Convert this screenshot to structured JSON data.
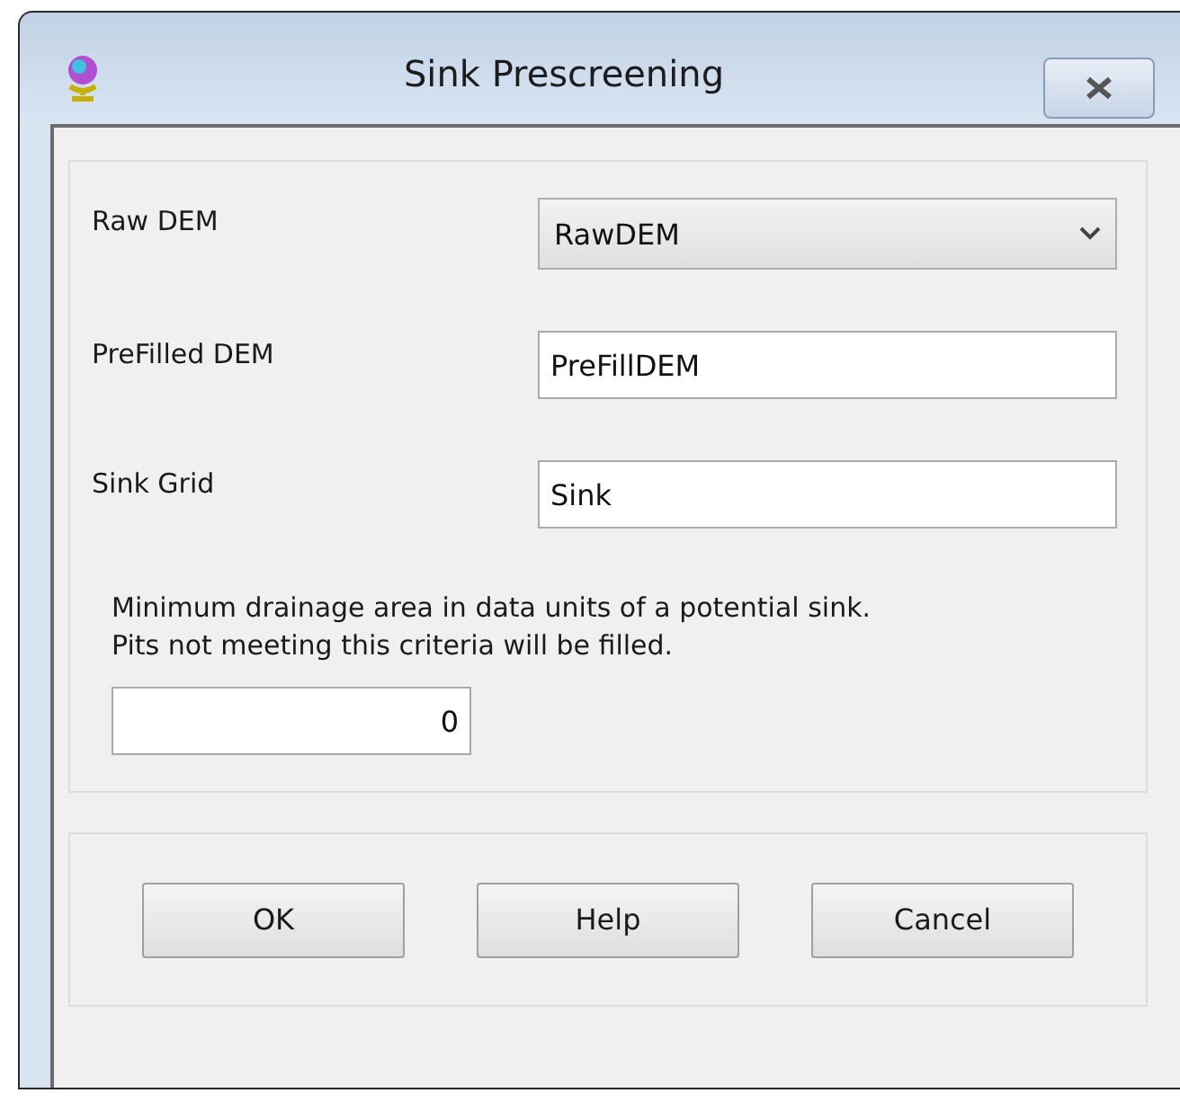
{
  "window": {
    "title": "Sink Prescreening"
  },
  "fields": [
    {
      "label": "Raw DEM",
      "kind": "combo",
      "value": "RawDEM"
    },
    {
      "label": "PreFilled DEM",
      "kind": "text",
      "value": "PreFillDEM"
    },
    {
      "label": "Sink Grid",
      "kind": "text",
      "value": "Sink"
    }
  ],
  "description": "Minimum drainage area in data units of a potential sink.\nPits not meeting this criteria will be filled.",
  "min_area": {
    "value": "0"
  },
  "buttons": [
    "OK",
    "Help",
    "Cancel"
  ]
}
